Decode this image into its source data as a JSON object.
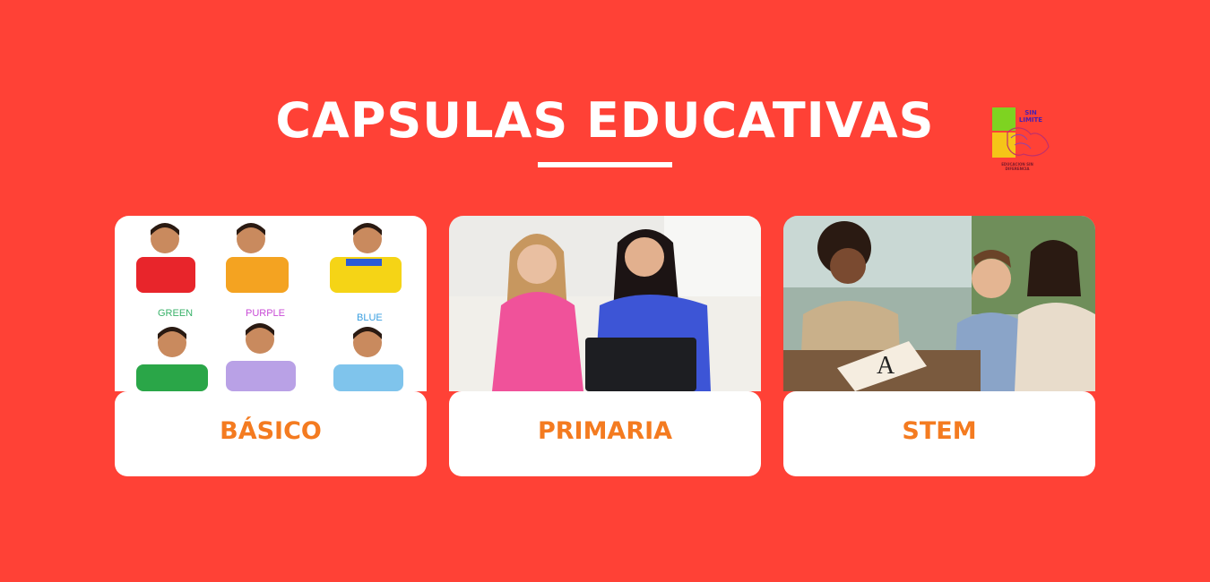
{
  "header": {
    "title": "CAPSULAS EDUCATIVAS"
  },
  "logo": {
    "name": "SIN LIMITE",
    "line1": "SIN",
    "line2": "LIMITE",
    "caption": "EDUCACION SIN DIFERENCIA",
    "colors": {
      "green": "#7ed321",
      "yellow": "#f5c518",
      "purple": "#8e44ad"
    }
  },
  "cards": [
    {
      "label": "BÁSICO",
      "image": "children-signing-colors-photo",
      "color_words": [
        "GREEN",
        "PURPLE",
        "BLUE"
      ]
    },
    {
      "label": "PRIMARIA",
      "image": "girl-and-woman-signing-laptop-photo"
    },
    {
      "label": "STEM",
      "image": "teacher-boy-mother-signing-photo"
    }
  ],
  "colors": {
    "background": "#ff4136",
    "card": "#ffffff",
    "label": "#f47b20",
    "title": "#ffffff"
  }
}
